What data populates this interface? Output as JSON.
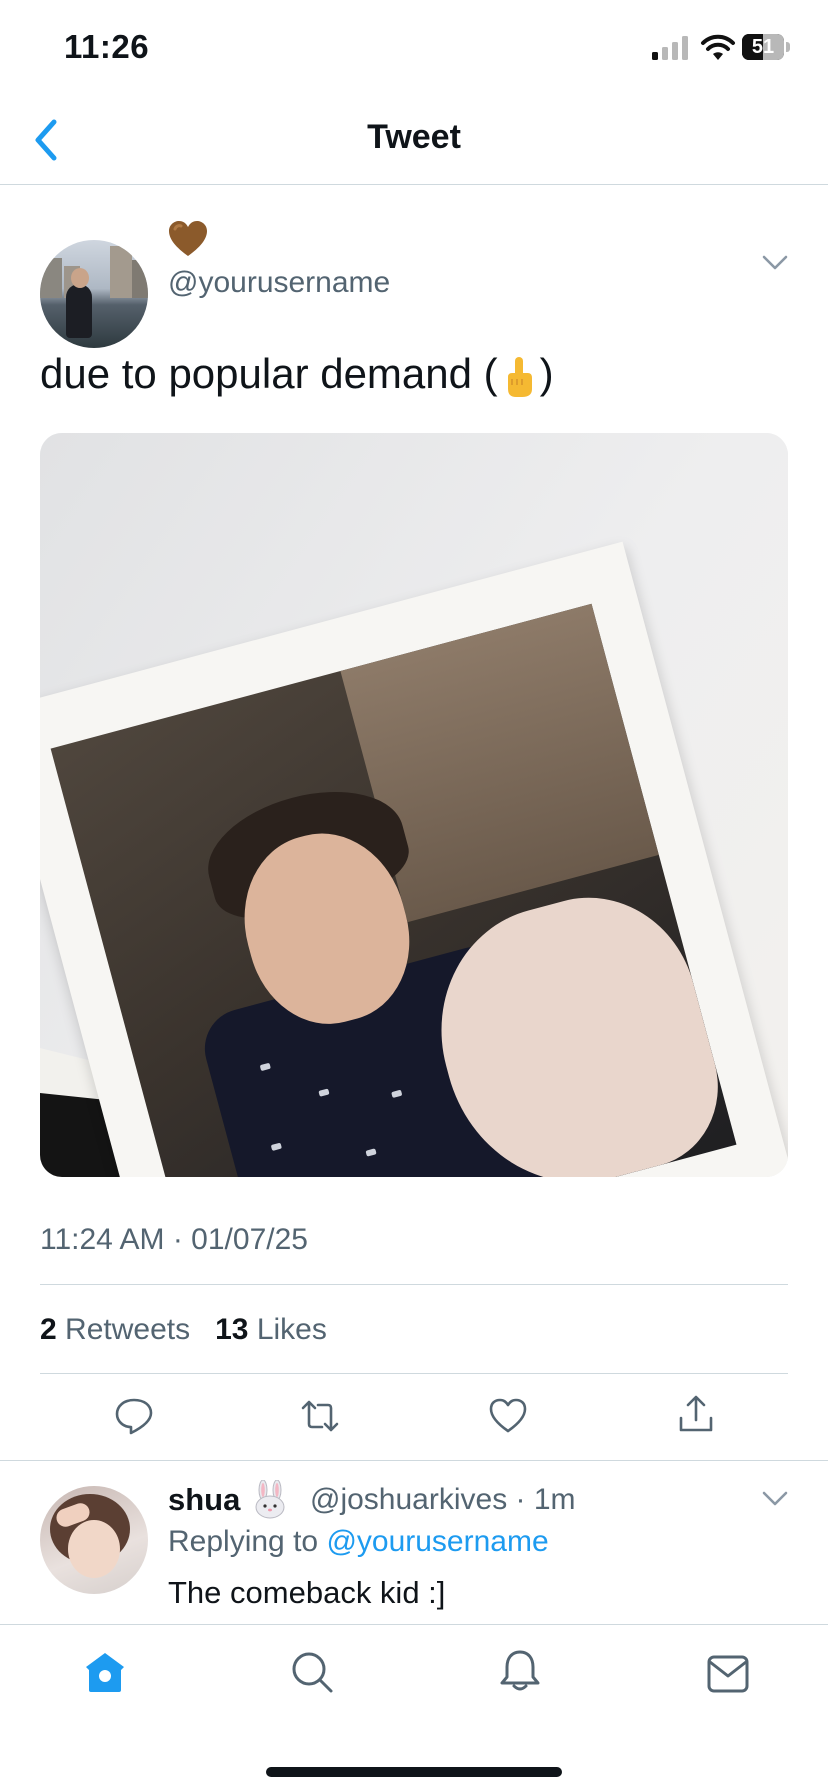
{
  "status_bar": {
    "time": "11:26",
    "battery": "51",
    "battery_level": 0.51
  },
  "header": {
    "title": "Tweet"
  },
  "tweet": {
    "handle": "@yourusername",
    "display_emoji": "brown-heart",
    "text_before": "due to popular demand (",
    "text_after": ")",
    "inline_emoji": "middle-finger",
    "timestamp": "11:24 AM · 01/07/25",
    "retweets_count": "2",
    "retweets_label": "Retweets",
    "likes_count": "13",
    "likes_label": "Likes"
  },
  "actions": [
    "reply-icon",
    "retweet-icon",
    "like-icon",
    "share-icon"
  ],
  "reply": {
    "name": "shua",
    "name_emoji": "rabbit-face",
    "handle_time": "@joshuarkives · 1m",
    "replying_prefix": "Replying to",
    "replying_handle": "@yourusername",
    "text": "The comeback kid :]"
  },
  "tab_bar": [
    "home-icon",
    "search-icon",
    "notifications-icon",
    "messages-icon"
  ],
  "colors": {
    "accent": "#1d9bf0",
    "secondary_text": "#536471",
    "divider": "#cfd9de"
  }
}
